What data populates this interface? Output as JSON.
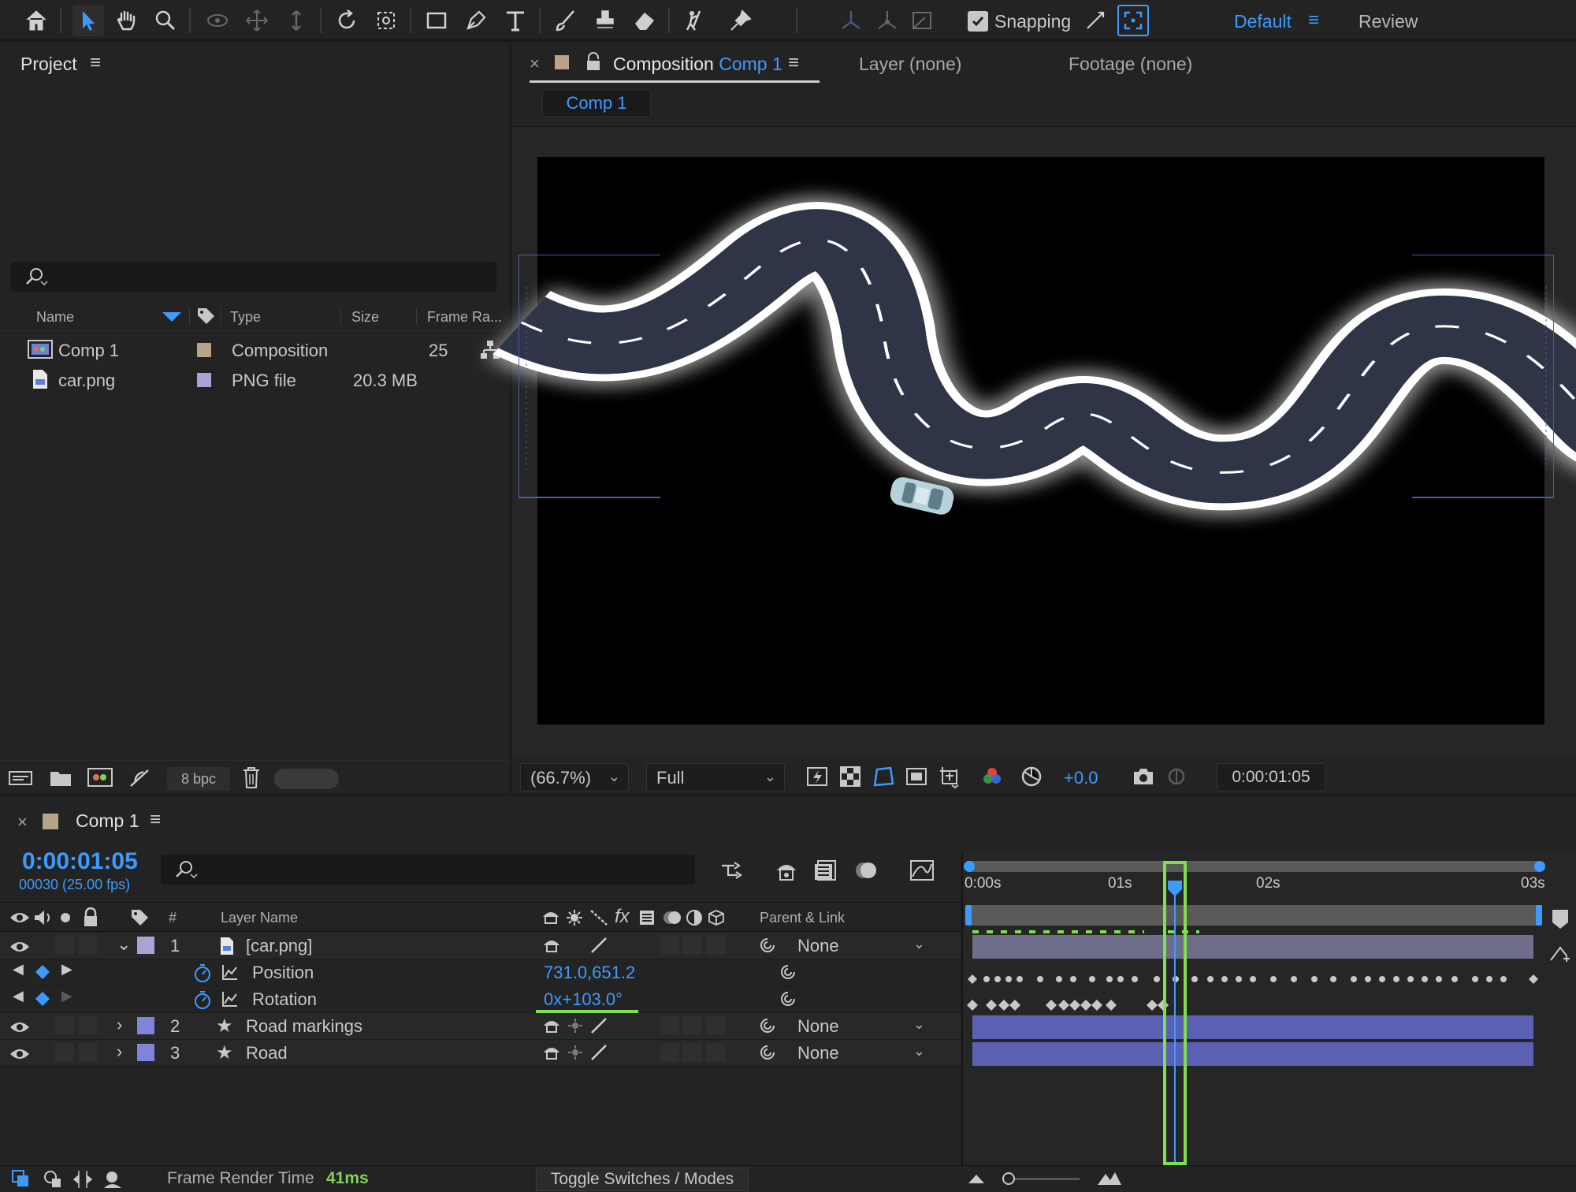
{
  "toolbar": {
    "snapping_label": "Snapping",
    "workspace_active": "Default",
    "workspace_other": "Review"
  },
  "project": {
    "title": "Project",
    "columns": [
      "Name",
      "Type",
      "Size",
      "Frame Ra..."
    ],
    "items": [
      {
        "name": "Comp 1",
        "type": "Composition",
        "size": "",
        "frame_rate": "25",
        "label_color": "#b8a488"
      },
      {
        "name": "car.png",
        "type": "PNG file",
        "size": "20.3 MB",
        "frame_rate": "",
        "label_color": "#a9a3d6"
      }
    ],
    "bpc": "8 bpc"
  },
  "composition": {
    "tab_prefix": "Composition",
    "tab_name": "Comp 1",
    "layer_tab": "Layer (none)",
    "footage_tab": "Footage (none)",
    "subtab": "Comp 1",
    "zoom": "(66.7%)",
    "resolution": "Full",
    "exposure": "+0.0",
    "current_time": "0:00:01:05"
  },
  "timeline": {
    "title": "Comp 1",
    "timecode": "0:00:01:05",
    "frames": "00030 (25.00 fps)",
    "header": {
      "number": "#",
      "layer_name": "Layer Name",
      "parent": "Parent & Link"
    },
    "ruler": [
      "0:00s",
      "01s",
      "02s",
      "03s"
    ],
    "layers": [
      {
        "num": "1",
        "name": "[car.png]",
        "parent": "None",
        "label_color": "#a9a3d6"
      },
      {
        "num": "2",
        "name": "Road markings",
        "parent": "None",
        "label_color": "#7e84d8"
      },
      {
        "num": "3",
        "name": "Road",
        "parent": "None",
        "label_color": "#7e84d8"
      }
    ],
    "properties": [
      {
        "name": "Position",
        "value": "731.0,651.2"
      },
      {
        "name": "Rotation",
        "value": "0x+103.0°"
      }
    ],
    "footer": {
      "render_label": "Frame Render Time",
      "render_value": "41ms",
      "toggle_label": "Toggle Switches / Modes"
    }
  },
  "colors": {
    "accent": "#3d9bff",
    "highlight": "#7ee04a",
    "layer_bar": "#6a6fbf",
    "road": "#2f3547"
  }
}
